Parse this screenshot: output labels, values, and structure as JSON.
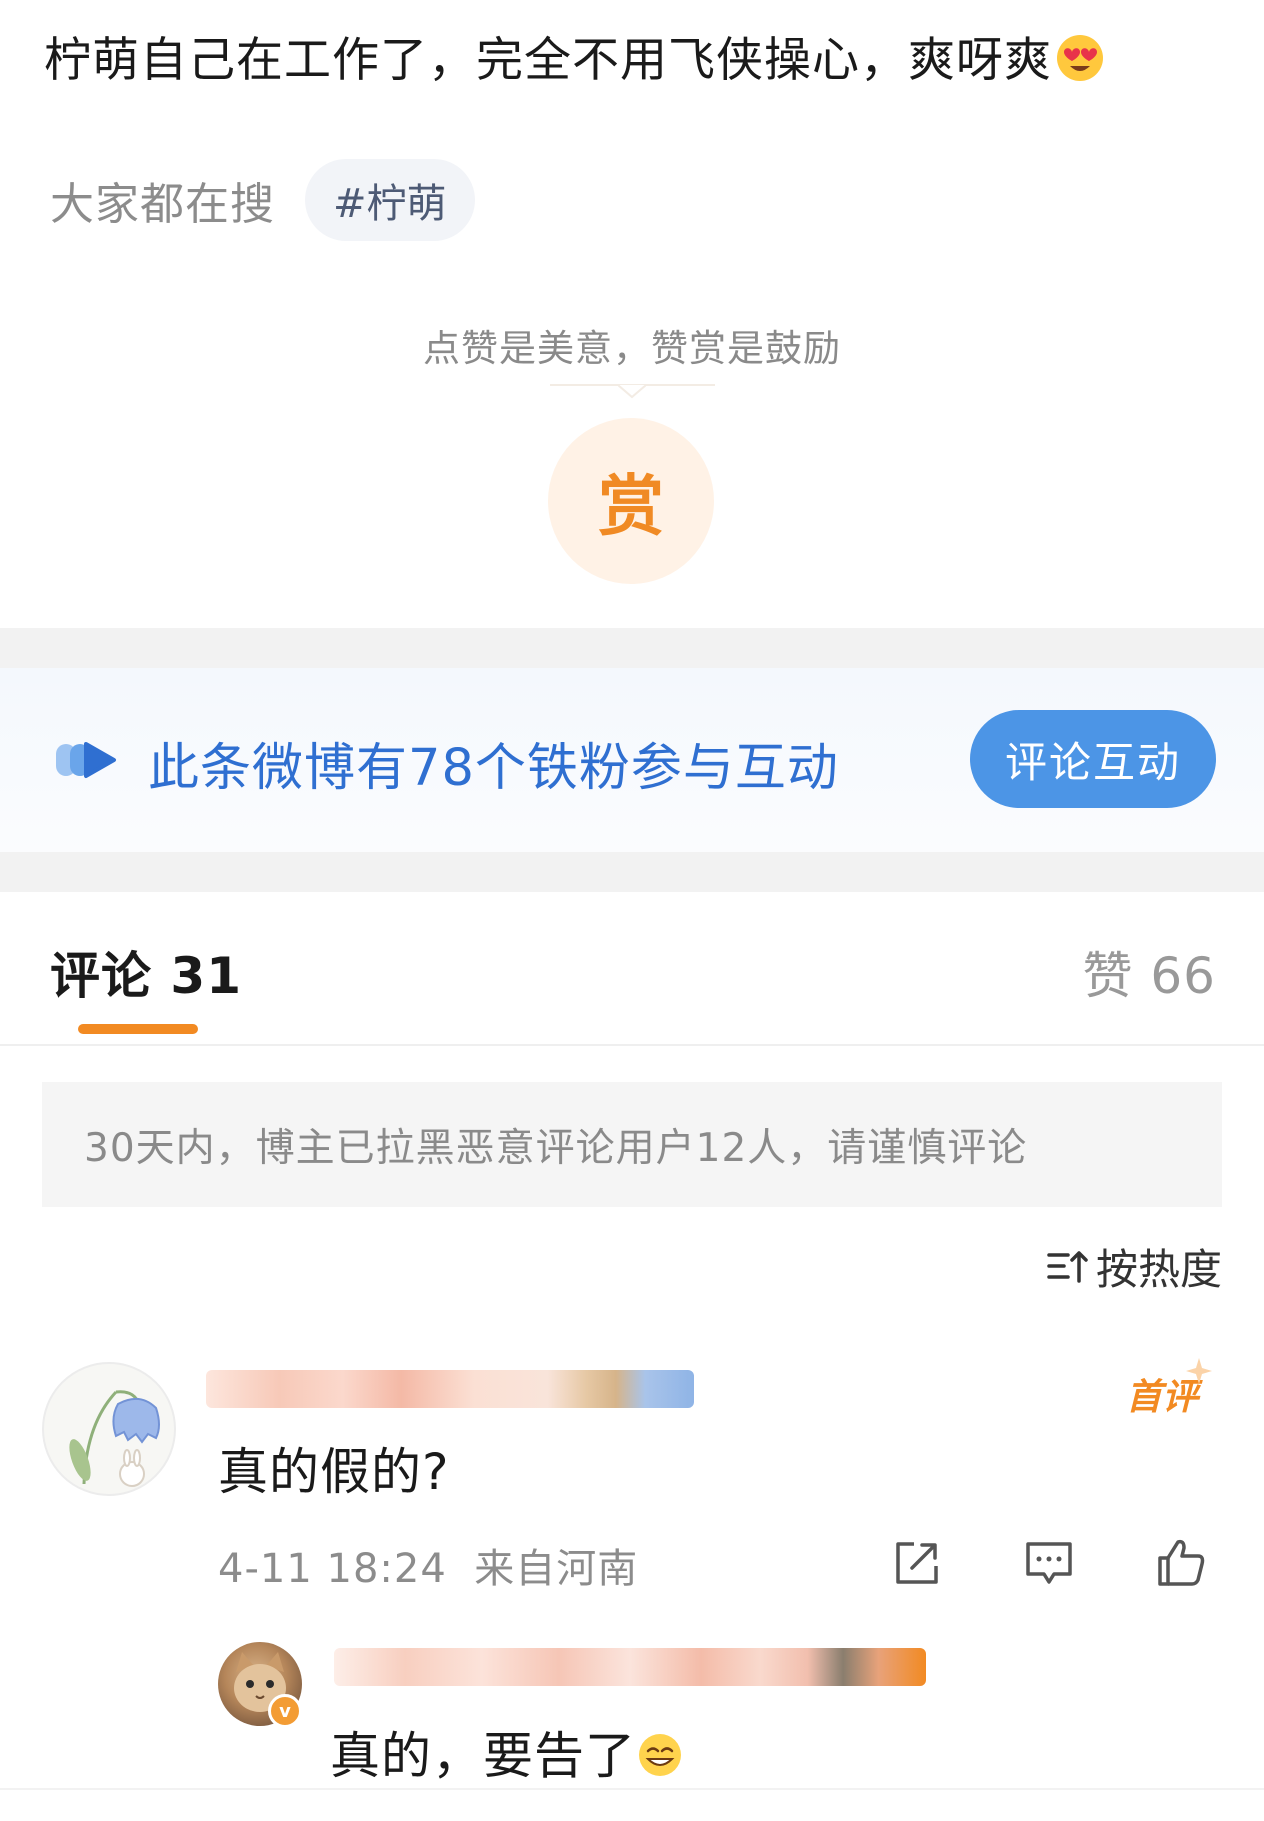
{
  "post": {
    "text": "柠萌自己在工作了，完全不用飞侠操心，爽呀爽",
    "emoji": "heart-eyes-emoji"
  },
  "search": {
    "label": "大家都在搜",
    "tag": "#柠萌"
  },
  "reward": {
    "caption": "点赞是美意，赞赏是鼓励",
    "button_label": "赏"
  },
  "fan_banner": {
    "text": "此条微博有78个铁粉参与互动",
    "button_label": "评论互动"
  },
  "tabs": {
    "comments_label": "评论",
    "comments_count": "31",
    "likes_label": "赞",
    "likes_count": "66"
  },
  "notice": "30天内，博主已拉黑恶意评论用户12人，请谨慎评论",
  "sort_label": "按热度",
  "comments": [
    {
      "badge": "首评",
      "text": "真的假的?",
      "time": "4-11 18:24",
      "location": "来自河南",
      "replies": [
        {
          "text": "真的，要告了",
          "emoji": "grin-emoji"
        }
      ]
    }
  ],
  "colors": {
    "accent_orange": "#f28a22",
    "link_blue": "#2f6fd1",
    "button_blue": "#4c95e6"
  }
}
